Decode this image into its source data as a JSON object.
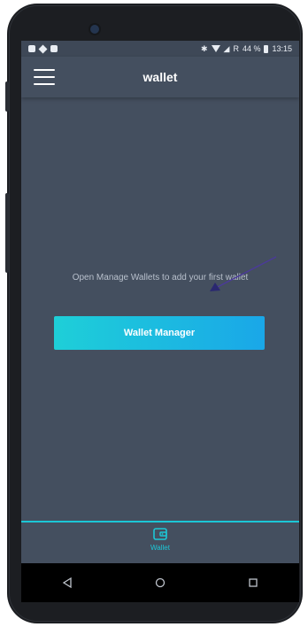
{
  "status_bar": {
    "battery_percent": "44 %",
    "time": "13:15",
    "network_indicator": "R",
    "icons": [
      "notification-icon",
      "location-icon",
      "image-icon",
      "bluetooth-icon",
      "wifi-icon",
      "signal-icon",
      "battery-icon"
    ]
  },
  "app_bar": {
    "title": "wallet",
    "menu_icon": "hamburger-menu-icon"
  },
  "main": {
    "empty_message": "Open Manage Wallets to add your first wallet",
    "primary_button": "Wallet Manager"
  },
  "bottom_nav": {
    "items": [
      {
        "label": "Wallet",
        "icon": "wallet-icon",
        "active": true
      }
    ]
  },
  "system_nav": {
    "icons": [
      "back-icon",
      "home-icon",
      "recents-icon"
    ]
  },
  "colors": {
    "background": "#444f5f",
    "accent": "#1cc7d6",
    "button_gradient_start": "#1ecfd8",
    "button_gradient_end": "#1aa7e8",
    "annotation_arrow": "#4b3a9a"
  }
}
